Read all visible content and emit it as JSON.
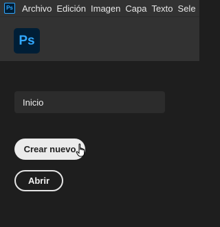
{
  "app": {
    "logo_text": "Ps",
    "brand_color": "#31a8ff",
    "brand_bg": "#001e36"
  },
  "menubar": {
    "items": [
      {
        "label": "Archivo"
      },
      {
        "label": "Edición"
      },
      {
        "label": "Imagen"
      },
      {
        "label": "Capa"
      },
      {
        "label": "Texto"
      },
      {
        "label": "Sele"
      }
    ]
  },
  "nav": {
    "home_label": "Inicio"
  },
  "actions": {
    "create_label": "Crear nuevo",
    "open_label": "Abrir"
  },
  "cursor": {
    "icon": "hand-pointer-icon"
  }
}
